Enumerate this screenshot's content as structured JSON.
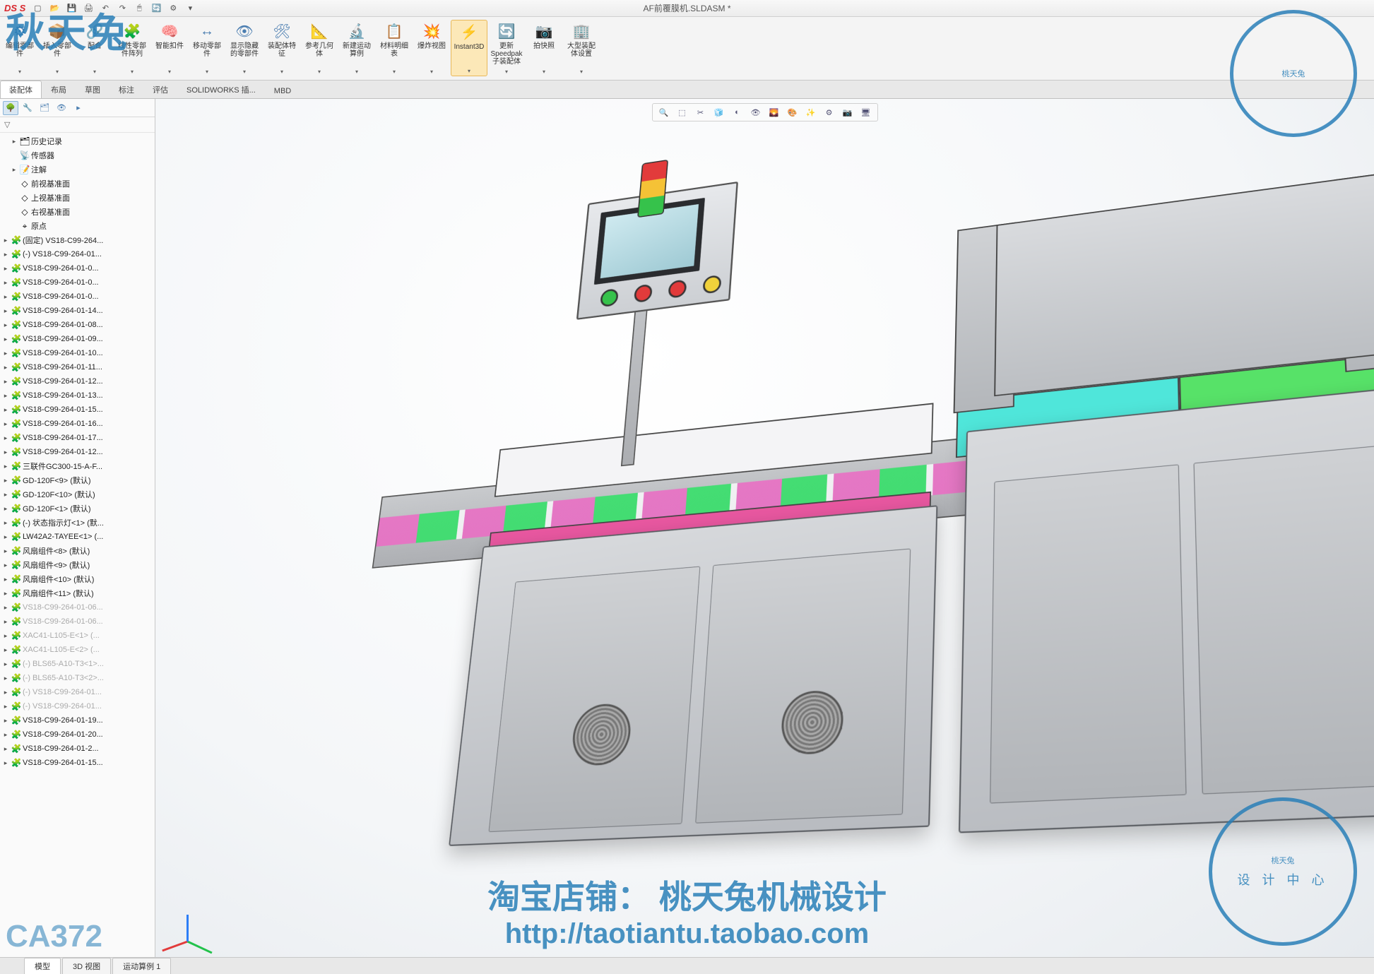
{
  "app": {
    "logo": "SOLIDWORKS",
    "doc_title": "AF前覆膜机.SLDASM *"
  },
  "qat": [
    "new",
    "open",
    "save",
    "print",
    "undo",
    "redo",
    "select",
    "rebuild",
    "options",
    "settings"
  ],
  "ribbon": [
    {
      "icon": "⚙",
      "label": "编辑零部件"
    },
    {
      "icon": "📦",
      "label": "插入零部件"
    },
    {
      "icon": "🔗",
      "label": "配合"
    },
    {
      "icon": "🧩",
      "label": "线性零部件阵列"
    },
    {
      "icon": "🧠",
      "label": "智能扣件"
    },
    {
      "icon": "↔",
      "label": "移动零部件"
    },
    {
      "icon": "👁",
      "label": "显示隐藏的零部件"
    },
    {
      "icon": "🛠",
      "label": "装配体特征"
    },
    {
      "icon": "📐",
      "label": "参考几何体"
    },
    {
      "icon": "🔬",
      "label": "新建运动算例"
    },
    {
      "icon": "📋",
      "label": "材料明细表"
    },
    {
      "icon": "💥",
      "label": "爆炸视图"
    },
    {
      "icon": "⚡",
      "label": "Instant3D",
      "active": true
    },
    {
      "icon": "🔄",
      "label": "更新Speedpak子装配体"
    },
    {
      "icon": "📷",
      "label": "拍快照"
    },
    {
      "icon": "🏢",
      "label": "大型装配体设置"
    }
  ],
  "cmd_tabs": [
    "装配体",
    "布局",
    "草图",
    "标注",
    "评估",
    "SOLIDWORKS 插...",
    "MBD"
  ],
  "cmd_tab_active": 0,
  "panel_icons": [
    "feature-tree",
    "property",
    "config",
    "display",
    "hide"
  ],
  "filter_label": "▽ ",
  "tree": [
    {
      "exp": "▸",
      "ico": "🗂",
      "lbl": "历史记录",
      "sub": true
    },
    {
      "exp": "",
      "ico": "📡",
      "lbl": "传感器",
      "sub": true
    },
    {
      "exp": "▸",
      "ico": "📝",
      "lbl": "注解",
      "sub": true
    },
    {
      "exp": "",
      "ico": "◇",
      "lbl": "前视基准面",
      "sub": true
    },
    {
      "exp": "",
      "ico": "◇",
      "lbl": "上视基准面",
      "sub": true
    },
    {
      "exp": "",
      "ico": "◇",
      "lbl": "右视基准面",
      "sub": true
    },
    {
      "exp": "",
      "ico": "⌖",
      "lbl": "原点",
      "sub": true
    },
    {
      "exp": "▸",
      "ico": "🧩",
      "lbl": "(固定) VS18-C99-264..."
    },
    {
      "exp": "▸",
      "ico": "🧩",
      "lbl": "(-) VS18-C99-264-01..."
    },
    {
      "exp": "▸",
      "ico": "🧩",
      "lbl": "VS18-C99-264-01-0..."
    },
    {
      "exp": "▸",
      "ico": "🧩",
      "lbl": "VS18-C99-264-01-0..."
    },
    {
      "exp": "▸",
      "ico": "🧩",
      "lbl": "VS18-C99-264-01-0..."
    },
    {
      "exp": "▸",
      "ico": "🧩",
      "lbl": "VS18-C99-264-01-14..."
    },
    {
      "exp": "▸",
      "ico": "🧩",
      "lbl": "VS18-C99-264-01-08..."
    },
    {
      "exp": "▸",
      "ico": "🧩",
      "lbl": "VS18-C99-264-01-09..."
    },
    {
      "exp": "▸",
      "ico": "🧩",
      "lbl": "VS18-C99-264-01-10..."
    },
    {
      "exp": "▸",
      "ico": "🧩",
      "lbl": "VS18-C99-264-01-11..."
    },
    {
      "exp": "▸",
      "ico": "🧩",
      "lbl": "VS18-C99-264-01-12..."
    },
    {
      "exp": "▸",
      "ico": "🧩",
      "lbl": "VS18-C99-264-01-13..."
    },
    {
      "exp": "▸",
      "ico": "🧩",
      "lbl": "VS18-C99-264-01-15..."
    },
    {
      "exp": "▸",
      "ico": "🧩",
      "lbl": "VS18-C99-264-01-16..."
    },
    {
      "exp": "▸",
      "ico": "🧩",
      "lbl": "VS18-C99-264-01-17..."
    },
    {
      "exp": "▸",
      "ico": "🧩",
      "lbl": "VS18-C99-264-01-12..."
    },
    {
      "exp": "▸",
      "ico": "🧩",
      "lbl": "三联件GC300-15-A-F..."
    },
    {
      "exp": "▸",
      "ico": "🧩",
      "lbl": "GD-120F<9> (默认)"
    },
    {
      "exp": "▸",
      "ico": "🧩",
      "lbl": "GD-120F<10> (默认)"
    },
    {
      "exp": "▸",
      "ico": "🧩",
      "lbl": "GD-120F<1> (默认)"
    },
    {
      "exp": "▸",
      "ico": "🧩",
      "lbl": "(-) 状态指示灯<1> (默..."
    },
    {
      "exp": "▸",
      "ico": "🧩",
      "lbl": "LW42A2-TAYEE<1> (..."
    },
    {
      "exp": "▸",
      "ico": "🧩",
      "lbl": "风扇组件<8> (默认)"
    },
    {
      "exp": "▸",
      "ico": "🧩",
      "lbl": "风扇组件<9> (默认)"
    },
    {
      "exp": "▸",
      "ico": "🧩",
      "lbl": "风扇组件<10> (默认)"
    },
    {
      "exp": "▸",
      "ico": "🧩",
      "lbl": "风扇组件<11> (默认)"
    },
    {
      "exp": "▸",
      "ico": "🧩",
      "lbl": "VS18-C99-264-01-06...",
      "faded": true
    },
    {
      "exp": "▸",
      "ico": "🧩",
      "lbl": "VS18-C99-264-01-06...",
      "faded": true
    },
    {
      "exp": "▸",
      "ico": "🧩",
      "lbl": "XAC41-L105-E<1> (...",
      "faded": true
    },
    {
      "exp": "▸",
      "ico": "🧩",
      "lbl": "XAC41-L105-E<2> (...",
      "faded": true
    },
    {
      "exp": "▸",
      "ico": "🧩",
      "lbl": "(-) BLS65-A10-T3<1>...",
      "faded": true
    },
    {
      "exp": "▸",
      "ico": "🧩",
      "lbl": "(-) BLS65-A10-T3<2>...",
      "faded": true
    },
    {
      "exp": "▸",
      "ico": "🧩",
      "lbl": "(-) VS18-C99-264-01...",
      "faded": true
    },
    {
      "exp": "▸",
      "ico": "🧩",
      "lbl": "(-) VS18-C99-264-01...",
      "faded": true
    },
    {
      "exp": "▸",
      "ico": "🧩",
      "lbl": "VS18-C99-264-01-19..."
    },
    {
      "exp": "▸",
      "ico": "🧩",
      "lbl": "VS18-C99-264-01-20..."
    },
    {
      "exp": "▸",
      "ico": "🧩",
      "lbl": "VS18-C99-264-01-2..."
    },
    {
      "exp": "▸",
      "ico": "🧩",
      "lbl": "VS18-C99-264-01-15..."
    }
  ],
  "heads_up": [
    "zoom",
    "section",
    "view",
    "display",
    "scene",
    "camera",
    "render",
    "perspective",
    "hide",
    "appearance",
    "decal",
    "settings",
    "screen"
  ],
  "bottom_tabs": [
    "模型",
    "3D 视图",
    "运动算例 1"
  ],
  "bottom_tab_active": 0,
  "watermark": {
    "top_left": "秋天兔",
    "top_right": "桃天兔",
    "bottom_left": "CA372",
    "center_line1": "淘宝店铺：  桃天兔机械设计",
    "center_line2": "http://taotiantu.taobao.com",
    "bottom_right_main": "桃天兔",
    "bottom_right_sub": "设 计 中 心"
  }
}
